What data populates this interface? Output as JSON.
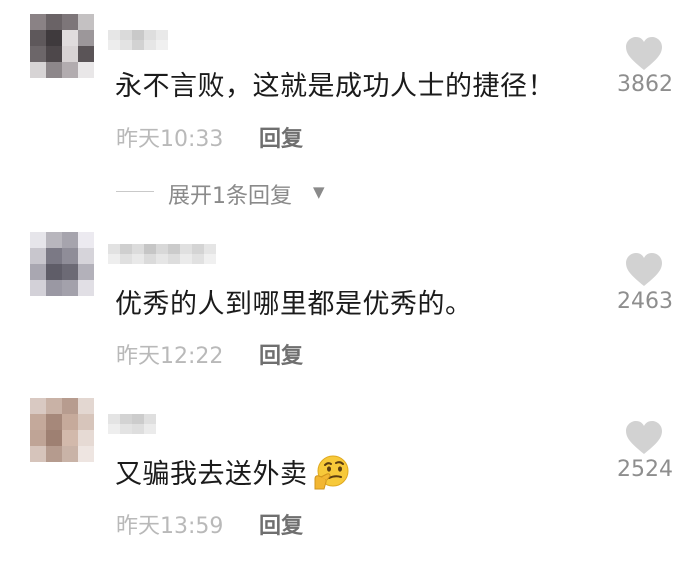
{
  "comments": [
    {
      "text": "永不言败，这就是成功人士的捷径！",
      "time": "昨天10:33",
      "reply_label": "回复",
      "likes": "3862",
      "expand_label": "展开1条回复"
    },
    {
      "text": "优秀的人到哪里都是优秀的。",
      "time": "昨天12:22",
      "reply_label": "回复",
      "likes": "2463"
    },
    {
      "text": "又骗我去送外卖",
      "emoji": "thinking-face-emoji",
      "time": "昨天13:59",
      "reply_label": "回复",
      "likes": "2524"
    }
  ],
  "icons": {
    "like": "heart-icon",
    "expand": "caret-down-icon"
  },
  "colors": {
    "comment_text": "#1b1b1b",
    "timestamp": "#b9b9b9",
    "reply": "#6f6f6f",
    "like_count": "#8e8e8e",
    "heart": "#d2d2d2"
  }
}
